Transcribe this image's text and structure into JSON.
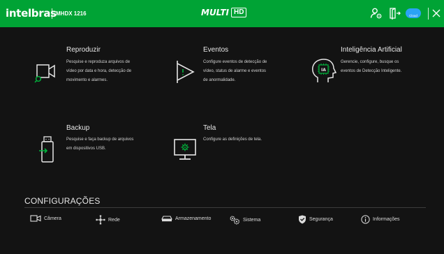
{
  "header": {
    "brand": "intelbras",
    "model": "MHDX 1216",
    "logo_text": "MULTI",
    "logo_badge": "HD",
    "cloud_label": "Cloud",
    "icons": [
      "user-settings-icon",
      "logout-icon",
      "cloud-icon",
      "close-icon"
    ]
  },
  "tiles": [
    {
      "title": "Reproduzir",
      "lines": [
        "Pesquise e reproduza arquivos de",
        "vídeo por data e hora, detecção de",
        "movimento e alarmes."
      ],
      "icon": "playback-camera-icon"
    },
    {
      "title": "Eventos",
      "lines": [
        "Configure eventos de detecção de",
        "vídeo, status de alarme e eventos",
        "de anormalidade."
      ],
      "icon": "flag-icon"
    },
    {
      "title": "Inteligência Artificial",
      "lines": [
        "Gerencie, configure, busque os",
        "eventos de Detecção Inteligente."
      ],
      "icon": "ai-head-icon"
    },
    {
      "title": "Backup",
      "lines": [
        "Pesquise e faça backup de arquivos",
        "em dispositivos USB."
      ],
      "icon": "usb-backup-icon"
    },
    {
      "title": "Tela",
      "lines": [
        "Configure as definições de tela."
      ],
      "icon": "monitor-settings-icon"
    }
  ],
  "config": {
    "title": "CONFIGURAÇÕES",
    "items": [
      {
        "label": "Câmera",
        "icon": "camera-icon"
      },
      {
        "label": "Rede",
        "icon": "network-icon"
      },
      {
        "label": "Armazenamento",
        "icon": "storage-icon"
      },
      {
        "label": "Sistema",
        "icon": "gears-icon"
      },
      {
        "label": "Segurança",
        "icon": "shield-icon"
      },
      {
        "label": "Informações",
        "icon": "info-icon"
      }
    ]
  },
  "colors": {
    "header_bg": "#00a335",
    "page_bg": "#131313",
    "icon_accent": "#00b53c",
    "cloud_badge": "#2aa3f5"
  }
}
